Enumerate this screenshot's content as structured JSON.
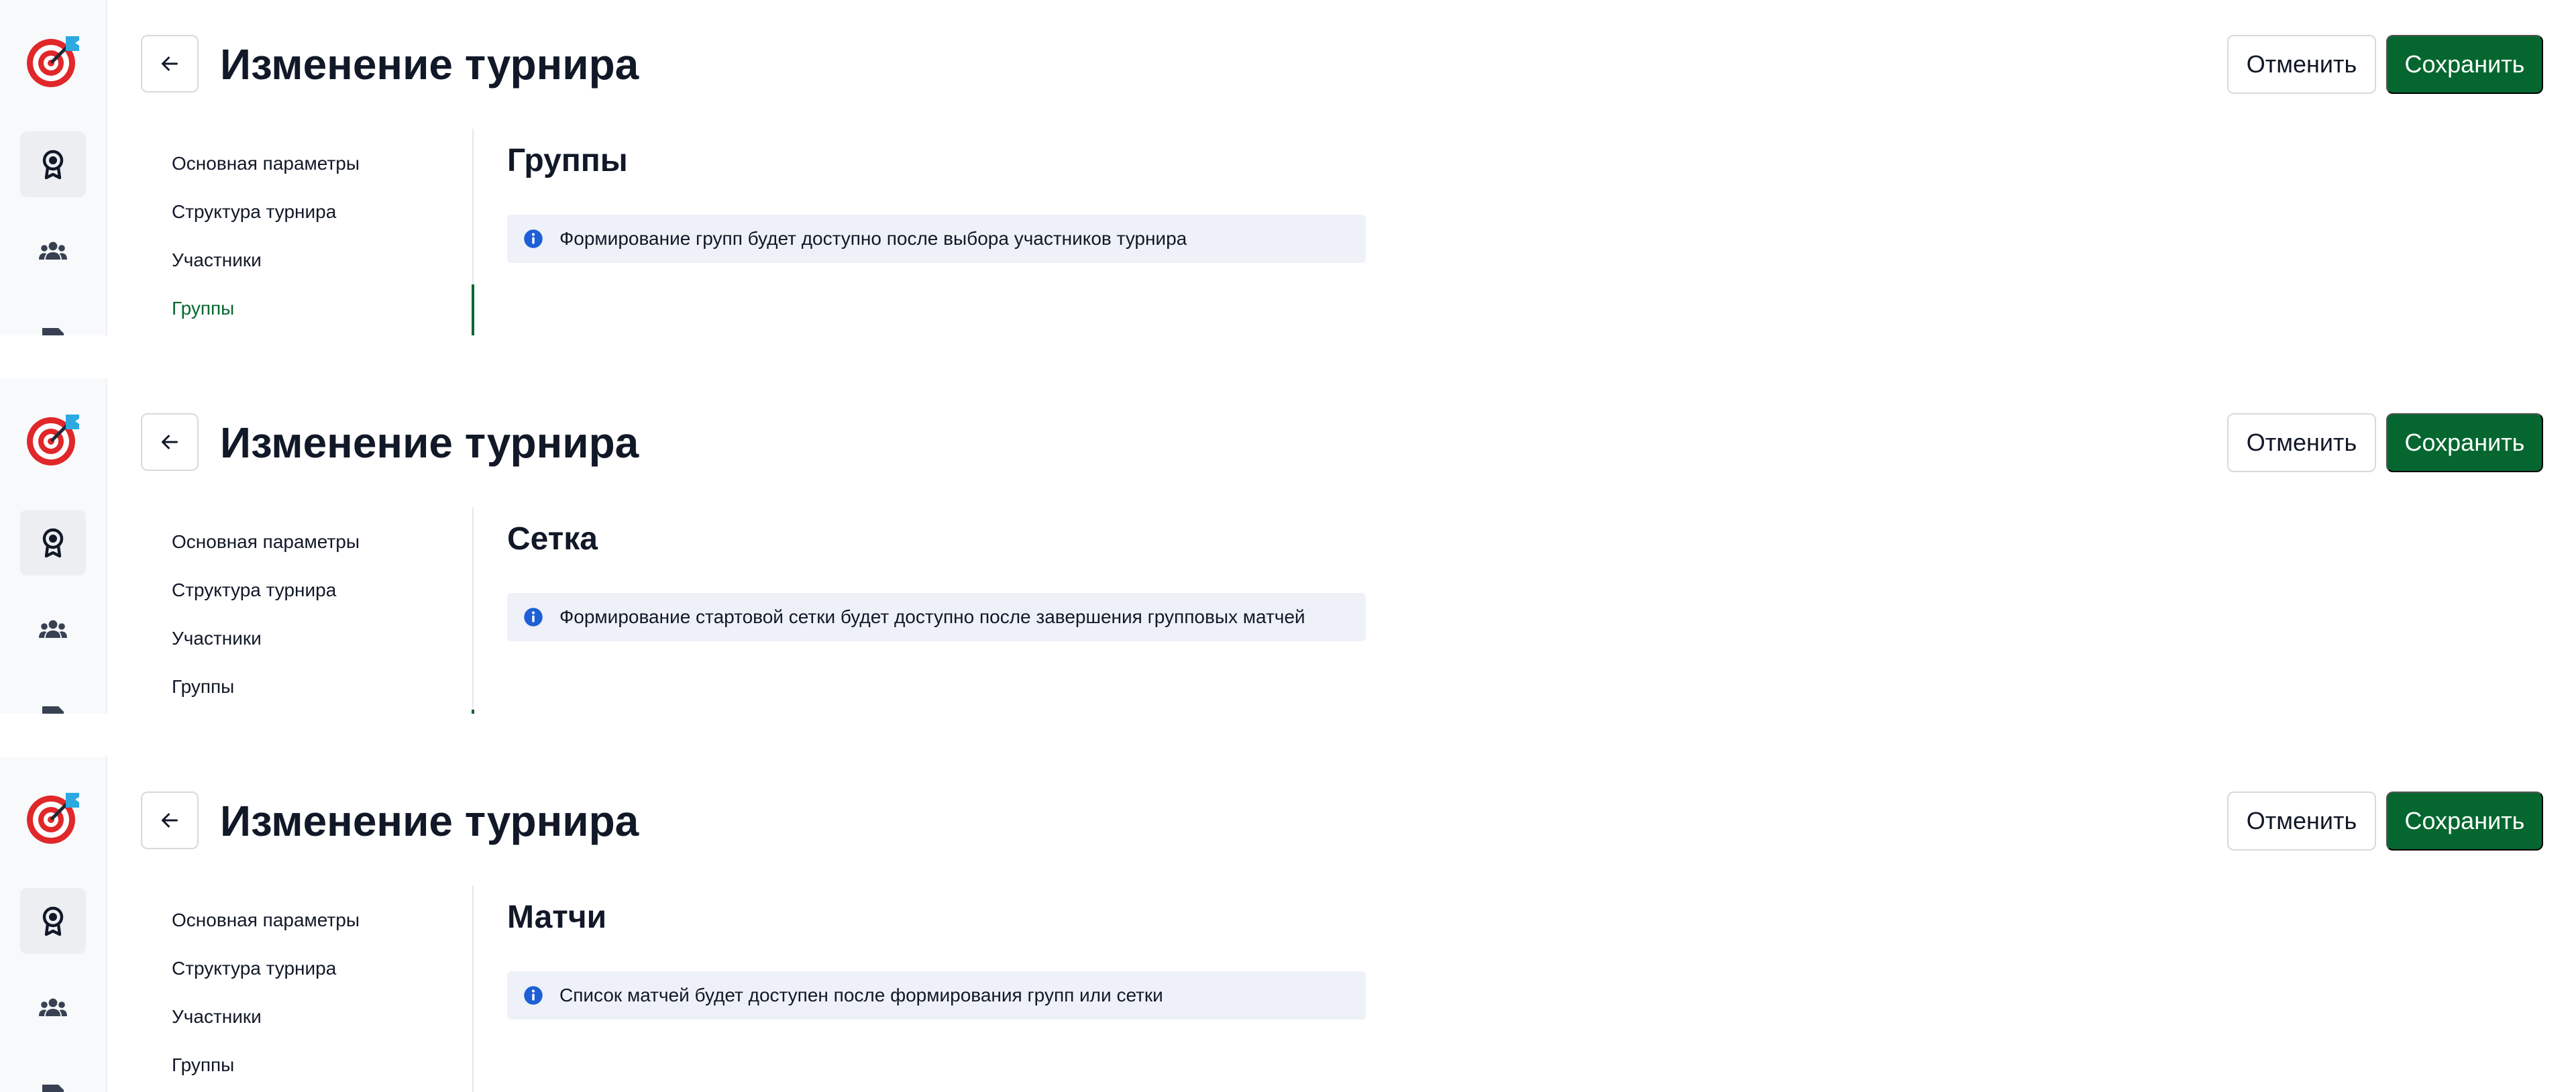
{
  "colors": {
    "primary": "#05672f",
    "info_bg": "#eef1f7",
    "info_icon": "#1d5fd6",
    "logo_red": "#e0272a",
    "logo_blue": "#2ba9e0"
  },
  "icons": {
    "rail": [
      "target-logo-icon",
      "medal-icon",
      "users-icon",
      "ticket-icon"
    ],
    "back": "arrow-left-icon",
    "info": "info-circle-icon"
  },
  "panels": [
    {
      "title": "Изменение турнира",
      "cancel_label": "Отменить",
      "save_label": "Сохранить",
      "nav": [
        "Основная параметры",
        "Структура турнира",
        "Участники",
        "Группы"
      ],
      "active_nav": "Группы",
      "section_title": "Группы",
      "info_text": "Формирование групп будет доступно после выбора участников турнира"
    },
    {
      "title": "Изменение турнира",
      "cancel_label": "Отменить",
      "save_label": "Сохранить",
      "nav": [
        "Основная параметры",
        "Структура турнира",
        "Участники",
        "Группы"
      ],
      "active_nav": "",
      "section_title": "Сетка",
      "info_text": "Формирование стартовой сетки будет доступно после завершения групповых матчей"
    },
    {
      "title": "Изменение турнира",
      "cancel_label": "Отменить",
      "save_label": "Сохранить",
      "nav": [
        "Основная параметры",
        "Структура турнира",
        "Участники",
        "Группы"
      ],
      "active_nav": "",
      "section_title": "Матчи",
      "info_text": "Список матчей будет доступен после формирования групп или сетки"
    }
  ]
}
